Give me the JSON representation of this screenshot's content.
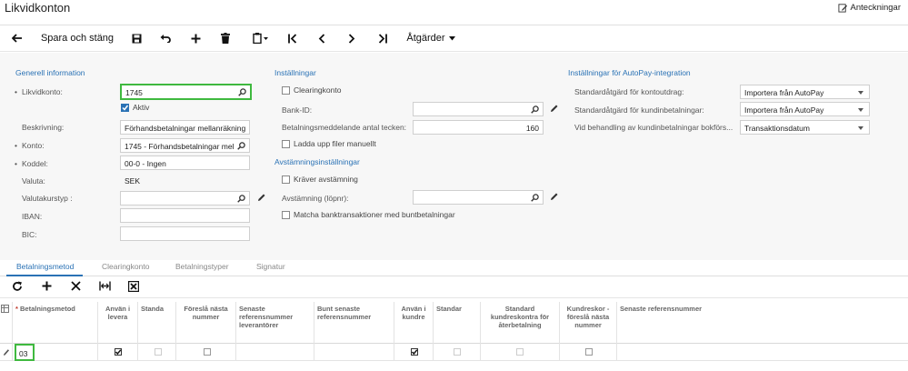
{
  "page": {
    "title": "Likvidkonton",
    "notes_label": "Anteckningar"
  },
  "toolbar": {
    "save_close": "Spara och stäng",
    "actions": "Åtgärder"
  },
  "general": {
    "header": "Generell information",
    "account_label": "Likvidkonto:",
    "account_value": "1745",
    "active_label": "Aktiv",
    "description_label": "Beskrivning:",
    "description_value": "Förhandsbetalningar mellanräkning",
    "konto_label": "Konto:",
    "konto_value": "1745 - Förhandsbetalningar mel",
    "koddel_label": "Koddel:",
    "koddel_value": "00-0 - Ingen",
    "currency_label": "Valuta:",
    "currency_value": "SEK",
    "rate_type_label": "Valutakurstyp :",
    "iban_label": "IBAN:",
    "bic_label": "BIC:"
  },
  "settings": {
    "header": "Inställningar",
    "clearing_label": "Clearingkonto",
    "bank_id_label": "Bank-ID:",
    "msg_chars_label": "Betalningsmeddelande antal tecken:",
    "msg_chars_value": "160",
    "upload_label": "Ladda upp filer manuellt"
  },
  "reconciliation": {
    "header": "Avstämningsinställningar",
    "requires_label": "Kräver avstämning",
    "recon_label": "Avstämning (löpnr):",
    "match_label": "Matcha banktransaktioner med buntbetalningar"
  },
  "autopay": {
    "header": "Inställningar för AutoPay-integration",
    "outgoing_label": "Standardåtgärd för kontoutdrag:",
    "outgoing_value": "Importera från AutoPay",
    "customer_label": "Standardåtgärd för kundinbetalningar:",
    "customer_value": "Importera från AutoPay",
    "booking_label": "Vid behandling av kundinbetalningar bokförs...",
    "booking_value": "Transaktionsdatum"
  },
  "tabs": [
    "Betalningsmetod",
    "Clearingkonto",
    "Betalningstyper",
    "Signatur"
  ],
  "grid": {
    "headers": [
      "Betalningsmetod",
      "Använ i leverа",
      "Standa",
      "Föreslå nästa nummer",
      "Senaste referensnummer leverantörer",
      "Bunt senaste referensnummer",
      "Använ i kundre",
      "Standar",
      "Standard kundreskontra för återbetalning",
      "Kundreskor - föreslå nästa nummer",
      "Senaste referensnummer"
    ],
    "rows": [
      {
        "method": "03"
      }
    ]
  },
  "colors": {
    "accent": "#2a72b5",
    "highlight": "#3fb93f"
  }
}
